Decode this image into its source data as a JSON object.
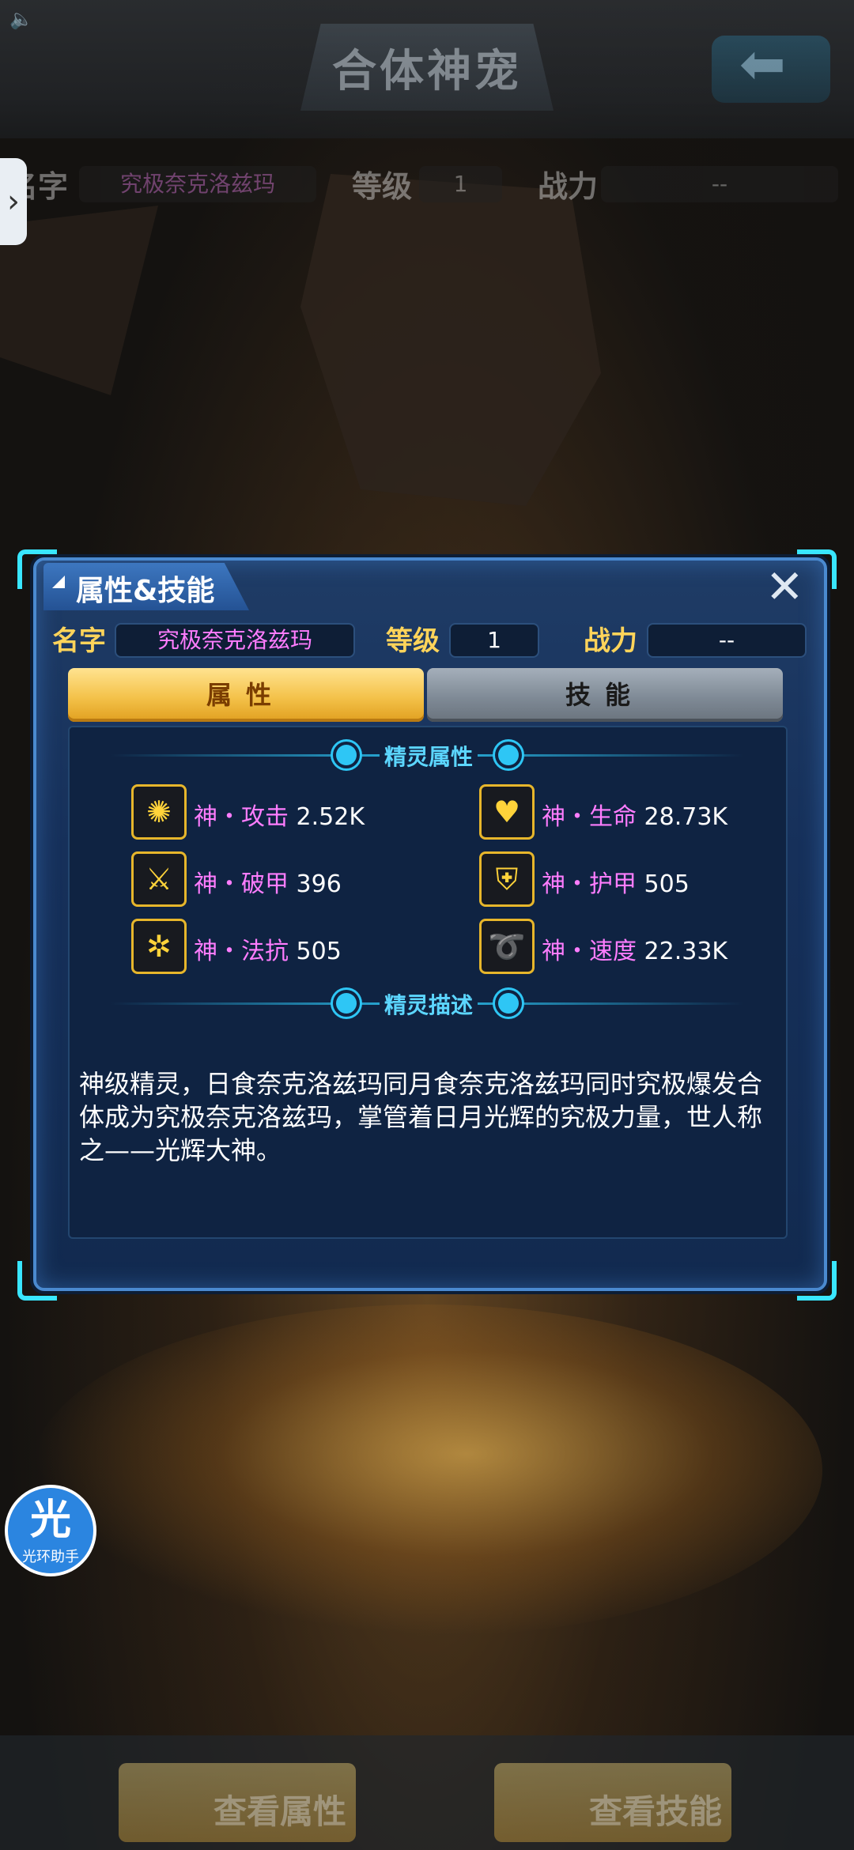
{
  "header": {
    "title": "合体神宠",
    "name_label": "名字",
    "name_value": "究极奈克洛兹玛",
    "level_label": "等级",
    "level_value": "1",
    "power_label": "战力",
    "power_value": "--"
  },
  "dialog": {
    "title": "属性&技能",
    "name_label": "名字",
    "name_value": "究极奈克洛兹玛",
    "level_label": "等级",
    "level_value": "1",
    "power_label": "战力",
    "power_value": "--",
    "tabs": [
      {
        "label": "属性",
        "active": true
      },
      {
        "label": "技能",
        "active": false
      }
    ],
    "attr_section_title": "精灵属性",
    "stats": [
      {
        "name": "神・攻击",
        "value": "2.52K",
        "icon": "attack-icon"
      },
      {
        "name": "神・生命",
        "value": "28.73K",
        "icon": "life-icon"
      },
      {
        "name": "神・破甲",
        "value": "396",
        "icon": "armor-break-icon"
      },
      {
        "name": "神・护甲",
        "value": "505",
        "icon": "armor-icon"
      },
      {
        "name": "神・法抗",
        "value": "505",
        "icon": "magic-resist-icon"
      },
      {
        "name": "神・速度",
        "value": "22.33K",
        "icon": "speed-icon"
      }
    ],
    "desc_section_title": "精灵描述",
    "description": "神级精灵，日食奈克洛兹玛同月食奈克洛兹玛同时究极爆发合体成为究极奈克洛兹玛，掌管着日月光辉的究极力量，世人称之——光辉大神。"
  },
  "helper": {
    "big": "光",
    "small": "光环助手"
  },
  "bottom": {
    "view_attr": "查看属性",
    "view_skill": "查看技能"
  },
  "colors": {
    "accent_cyan": "#39e6ff",
    "gold": "#ffd45a",
    "stat_name": "#ff7dff",
    "name_value": "#ff7dff"
  }
}
